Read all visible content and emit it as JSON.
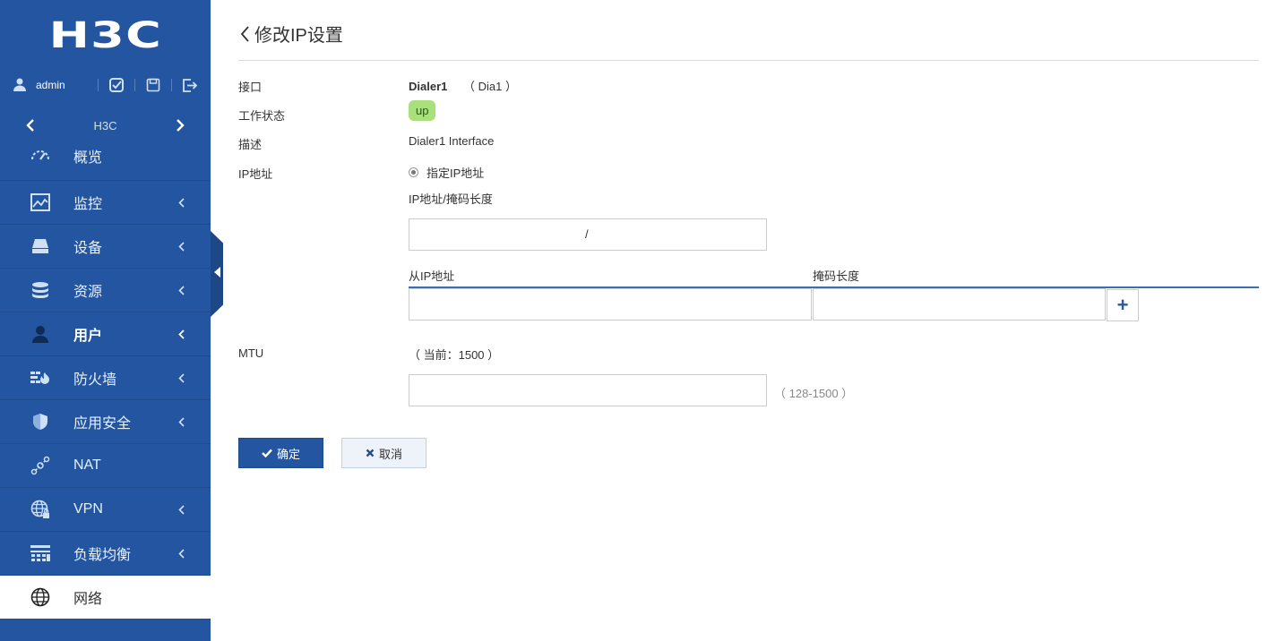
{
  "sidebar": {
    "logo": "H3C",
    "user": "admin",
    "device": "H3C",
    "items": [
      {
        "label": "概览",
        "icon": "dashboard-icon",
        "has_arrow": false
      },
      {
        "label": "监控",
        "icon": "monitor-chart-icon",
        "has_arrow": true
      },
      {
        "label": "设备",
        "icon": "device-icon",
        "has_arrow": true
      },
      {
        "label": "资源",
        "icon": "database-icon",
        "has_arrow": true
      },
      {
        "label": "用户",
        "icon": "user-icon",
        "has_arrow": true
      },
      {
        "label": "防火墙",
        "icon": "firewall-icon",
        "has_arrow": true
      },
      {
        "label": "应用安全",
        "icon": "shield-icon",
        "has_arrow": true
      },
      {
        "label": "NAT",
        "icon": "nat-icon",
        "has_arrow": false
      },
      {
        "label": "VPN",
        "icon": "globe-lock-icon",
        "has_arrow": true
      },
      {
        "label": "负载均衡",
        "icon": "load-balance-icon",
        "has_arrow": true
      },
      {
        "label": "网络",
        "icon": "globe-icon",
        "has_arrow": false
      }
    ]
  },
  "page": {
    "title": "修改IP设置"
  },
  "form": {
    "interface_label": "接口",
    "interface_name": "Dialer1",
    "interface_short": "（ Dia1 ）",
    "status_label": "工作状态",
    "status_value": "up",
    "desc_label": "描述",
    "desc_value": "Dialer1 Interface",
    "ip_label": "IP地址",
    "ip_mode": "指定IP地址",
    "ip_mask_label": "IP地址/掩码长度",
    "ip_mask_value": "",
    "slash": "/",
    "sub_ip_label": "从IP地址",
    "sub_mask_label": "掩码长度",
    "sub_ip_value": "",
    "sub_mask_value": "",
    "add_label": "+",
    "mtu_label": "MTU",
    "mtu_current": "（ 当前：1500 ）",
    "mtu_value": "",
    "mtu_range": "（ 128-1500 ）"
  },
  "buttons": {
    "ok": "确定",
    "cancel": "取消"
  },
  "colors": {
    "sidebar": "#2355a0",
    "status_badge": "#a7e07c",
    "accent": "#3a6db4"
  }
}
